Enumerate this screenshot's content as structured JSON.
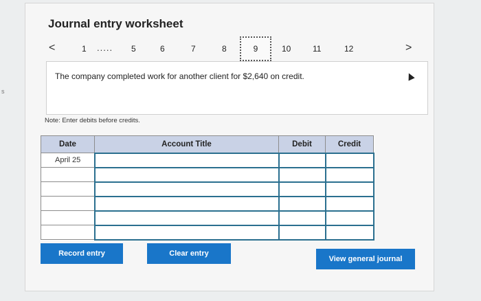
{
  "edge_letter": "s",
  "title": "Journal entry worksheet",
  "pager": {
    "prev": "<",
    "next": ">",
    "pages": [
      "1",
      "5",
      "6",
      "7",
      "8",
      "9",
      "10",
      "11",
      "12"
    ],
    "ellipsis": ".....",
    "current": "9"
  },
  "prompt": "The company completed work for another client for $2,640 on credit.",
  "note": "Note: Enter debits before credits.",
  "table": {
    "headers": [
      "Date",
      "Account Title",
      "Debit",
      "Credit"
    ],
    "rows": [
      [
        "April 25",
        "",
        "",
        ""
      ],
      [
        "",
        "",
        "",
        ""
      ],
      [
        "",
        "",
        "",
        ""
      ],
      [
        "",
        "",
        "",
        ""
      ],
      [
        "",
        "",
        "",
        ""
      ],
      [
        "",
        "",
        "",
        ""
      ]
    ]
  },
  "buttons": {
    "record": "Record entry",
    "clear": "Clear entry",
    "view": "View general journal"
  },
  "colors": {
    "button": "#1976c9",
    "header": "#c9d2e6",
    "entry_border": "#2a6f8f"
  }
}
